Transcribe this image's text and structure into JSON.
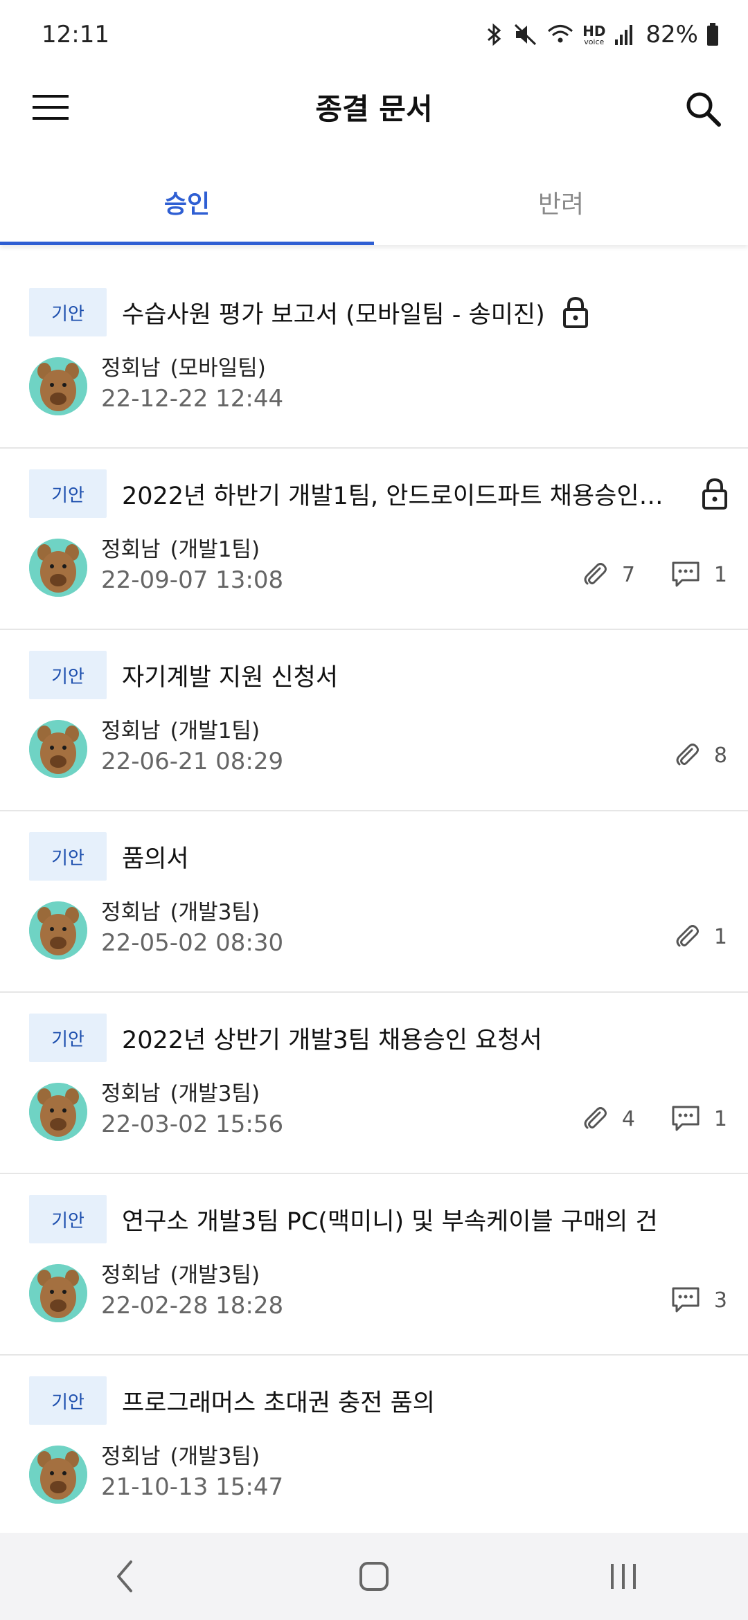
{
  "status": {
    "time": "12:11",
    "hd_label": "HD",
    "voice_label": "voice",
    "battery": "82%"
  },
  "app_bar": {
    "title": "종결 문서",
    "menu_icon": "menu-icon",
    "search_icon": "search-icon"
  },
  "tabs": [
    {
      "label": "승인",
      "active": true
    },
    {
      "label": "반려",
      "active": false
    }
  ],
  "documents": [
    {
      "badge": "기안",
      "title": "수습사원 평가 보고서 (모바일팀 - 송미진)",
      "locked": true,
      "author": "정회남",
      "team": "(모바일팀)",
      "date": "22-12-22 12:44",
      "attachments": "",
      "comments": ""
    },
    {
      "badge": "기안",
      "title": "2022년 하반기 개발1팀, 안드로이드파트 채용승인 요...",
      "locked": true,
      "author": "정회남",
      "team": "(개발1팀)",
      "date": "22-09-07 13:08",
      "attachments": "7",
      "comments": "1"
    },
    {
      "badge": "기안",
      "title": "자기계발 지원 신청서",
      "locked": false,
      "author": "정회남",
      "team": "(개발1팀)",
      "date": "22-06-21 08:29",
      "attachments": "8",
      "comments": ""
    },
    {
      "badge": "기안",
      "title": "품의서",
      "locked": false,
      "author": "정회남",
      "team": "(개발3팀)",
      "date": "22-05-02 08:30",
      "attachments": "1",
      "comments": ""
    },
    {
      "badge": "기안",
      "title": "2022년 상반기 개발3팀 채용승인 요청서",
      "locked": false,
      "author": "정회남",
      "team": "(개발3팀)",
      "date": "22-03-02 15:56",
      "attachments": "4",
      "comments": "1"
    },
    {
      "badge": "기안",
      "title": "연구소 개발3팀 PC(맥미니) 및 부속케이블 구매의 건",
      "locked": false,
      "author": "정회남",
      "team": "(개발3팀)",
      "date": "22-02-28 18:28",
      "attachments": "",
      "comments": "3"
    },
    {
      "badge": "기안",
      "title": "프로그래머스 초대권 충전 품의",
      "locked": false,
      "author": "정회남",
      "team": "(개발3팀)",
      "date": "21-10-13 15:47",
      "attachments": "",
      "comments": ""
    }
  ],
  "colors": {
    "accent": "#2f5fd3",
    "badge_bg": "#e6f0fb",
    "badge_text": "#1d4fae",
    "avatar_bg": "#6fd3c4"
  },
  "nav": {
    "back_icon": "back-icon",
    "home_icon": "home-icon",
    "recents_icon": "recents-icon"
  }
}
